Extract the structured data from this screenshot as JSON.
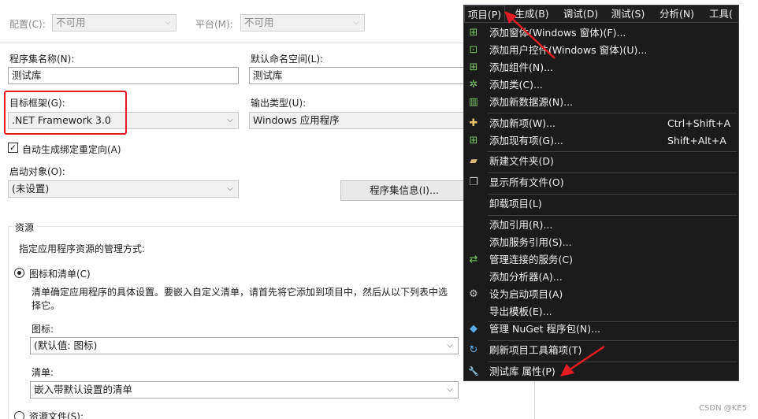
{
  "toolbar": {
    "config_label": "配置(C):",
    "config_value": "不可用",
    "platform_label": "平台(M):",
    "platform_value": "不可用"
  },
  "form": {
    "assembly_name_label": "程序集名称(N):",
    "assembly_name_value": "测试库",
    "default_namespace_label": "默认命名空间(L):",
    "default_namespace_value": "测试库",
    "target_framework_label": "目标框架(G):",
    "target_framework_value": ".NET Framework 3.0",
    "output_type_label": "输出类型(U):",
    "output_type_value": "Windows 应用程序",
    "auto_binding_label": "自动生成绑定重定向(A)",
    "auto_binding_checked": true,
    "startup_object_label": "启动对象(O):",
    "startup_object_value": "(未设置)",
    "assembly_info_button": "程序集信息(I)..."
  },
  "resources": {
    "group_title": "资源",
    "description": "指定应用程序资源的管理方式:",
    "icon_manifest_option": "图标和清单(C)",
    "icon_manifest_help_1": "清单确定应用程序的具体设置。要嵌入自定义清单，请首先将它添加到项目中，然后从以下列表中选",
    "icon_manifest_help_2": "择它。",
    "icon_label": "图标:",
    "icon_value": "(默认值: 图标)",
    "manifest_label": "清单:",
    "manifest_value": "嵌入带默认设置的清单",
    "resource_file_option": "资源文件(S):"
  },
  "menubar": {
    "items": [
      "项目(P)",
      "生成(B)",
      "调试(D)",
      "测试(S)",
      "分析(N)",
      "工具("
    ]
  },
  "menu": {
    "items": [
      {
        "label": "添加窗体(Windows 窗体)(F)...",
        "shortcut": "",
        "icon": "form-add-icon",
        "glyph": "⊞"
      },
      {
        "label": "添加用户控件(Windows 窗体)(U)...",
        "shortcut": "",
        "icon": "user-control-add-icon",
        "glyph": "⊡"
      },
      {
        "label": "添加组件(N)...",
        "shortcut": "",
        "icon": "component-add-icon",
        "glyph": "⊞"
      },
      {
        "label": "添加类(C)...",
        "shortcut": "",
        "icon": "class-add-icon",
        "glyph": "✲"
      },
      {
        "label": "添加新数据源(N)...",
        "shortcut": "",
        "icon": "datasource-add-icon",
        "glyph": "▥"
      },
      {
        "label": "添加新项(W)...",
        "shortcut": "Ctrl+Shift+A",
        "icon": "new-item-icon",
        "glyph": "✚"
      },
      {
        "label": "添加现有项(G)...",
        "shortcut": "Shift+Alt+A",
        "icon": "existing-item-icon",
        "glyph": "⊞"
      },
      {
        "label": "新建文件夹(D)",
        "shortcut": "",
        "icon": "new-folder-icon",
        "glyph": "▰"
      },
      {
        "label": "显示所有文件(O)",
        "shortcut": "",
        "icon": "show-all-files-icon",
        "glyph": "❐"
      },
      {
        "label": "卸载项目(L)",
        "shortcut": "",
        "icon": "",
        "glyph": ""
      },
      {
        "label": "添加引用(R)...",
        "shortcut": "",
        "icon": "",
        "glyph": ""
      },
      {
        "label": "添加服务引用(S)...",
        "shortcut": "",
        "icon": "",
        "glyph": ""
      },
      {
        "label": "管理连接的服务(C)",
        "shortcut": "",
        "icon": "connected-services-icon",
        "glyph": "⇄"
      },
      {
        "label": "添加分析器(A)...",
        "shortcut": "",
        "icon": "",
        "glyph": ""
      },
      {
        "label": "设为启动项目(A)",
        "shortcut": "",
        "icon": "gear-icon",
        "glyph": "⚙"
      },
      {
        "label": "导出模板(E)...",
        "shortcut": "",
        "icon": "",
        "glyph": ""
      },
      {
        "label": "管理 NuGet 程序包(N)...",
        "shortcut": "",
        "icon": "nuget-icon",
        "glyph": "◆"
      },
      {
        "label": "刷新项目工具箱项(T)",
        "shortcut": "",
        "icon": "refresh-icon",
        "glyph": "↻"
      },
      {
        "label": "测试库 属性(P)",
        "shortcut": "",
        "icon": "wrench-icon",
        "glyph": "🔧"
      }
    ]
  },
  "watermark": "CSDN @KE5",
  "colors": {
    "highlight_red": "#e31b23",
    "menu_bg": "#1b1b1c",
    "menu_text": "#f1f1f1"
  }
}
